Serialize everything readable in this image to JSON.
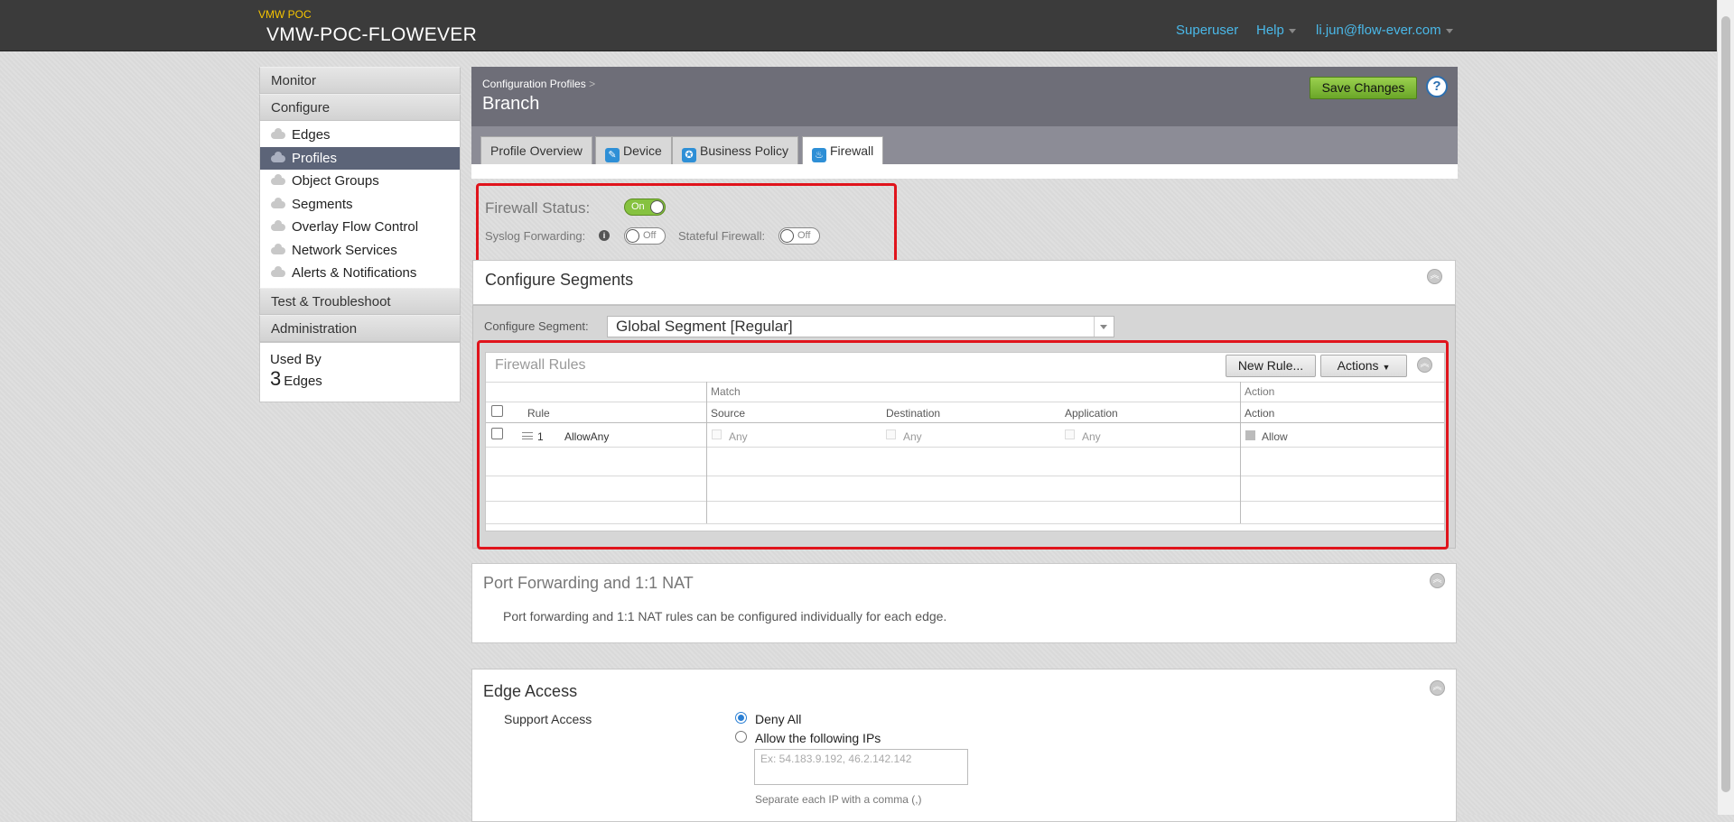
{
  "header": {
    "org_label": "VMW POC",
    "app_title": "VMW-POC-FLOWEVER",
    "nav": {
      "role": "Superuser",
      "help": "Help",
      "user": "li.jun@flow-ever.com"
    }
  },
  "sidebar": {
    "monitor": "Monitor",
    "configure": "Configure",
    "items": [
      {
        "label": "Edges"
      },
      {
        "label": "Profiles"
      },
      {
        "label": "Object Groups"
      },
      {
        "label": "Segments"
      },
      {
        "label": "Overlay Flow Control"
      },
      {
        "label": "Network Services"
      },
      {
        "label": "Alerts & Notifications"
      }
    ],
    "test": "Test & Troubleshoot",
    "admin": "Administration",
    "used_by": {
      "label": "Used By",
      "count": "3",
      "unit": "Edges"
    }
  },
  "page": {
    "breadcrumb": "Configuration Profiles",
    "breadcrumb_sep": ">",
    "title": "Branch",
    "save": "Save Changes",
    "help": "?"
  },
  "tabs": [
    {
      "label": "Profile Overview"
    },
    {
      "label": "Device"
    },
    {
      "label": "Business Policy"
    },
    {
      "label": "Firewall"
    }
  ],
  "firewall": {
    "status_label": "Firewall Status:",
    "status_value": "On",
    "syslog_label": "Syslog Forwarding:",
    "syslog_value": "Off",
    "stateful_label": "Stateful Firewall:",
    "stateful_value": "Off"
  },
  "segments": {
    "title": "Configure Segments",
    "segment_label": "Configure Segment:",
    "segment_value": "Global Segment [Regular]"
  },
  "rules": {
    "title": "Firewall Rules",
    "new_rule": "New Rule...",
    "actions": "Actions",
    "group_match": "Match",
    "group_action": "Action",
    "col_rule": "Rule",
    "col_source": "Source",
    "col_destination": "Destination",
    "col_application": "Application",
    "col_action": "Action",
    "rows": [
      {
        "num": "1",
        "name": "AllowAny",
        "source": "Any",
        "destination": "Any",
        "application": "Any",
        "action": "Allow"
      }
    ]
  },
  "port_forwarding": {
    "title": "Port Forwarding and 1:1 NAT",
    "text": "Port forwarding and 1:1 NAT rules can be configured individually for each edge."
  },
  "edge_access": {
    "title": "Edge Access",
    "support_label": "Support Access",
    "deny_all": "Deny All",
    "allow_ips": "Allow the following IPs",
    "ip_placeholder": "Ex: 54.183.9.192, 46.2.142.142",
    "hint": "Separate each IP with a comma (,)"
  }
}
